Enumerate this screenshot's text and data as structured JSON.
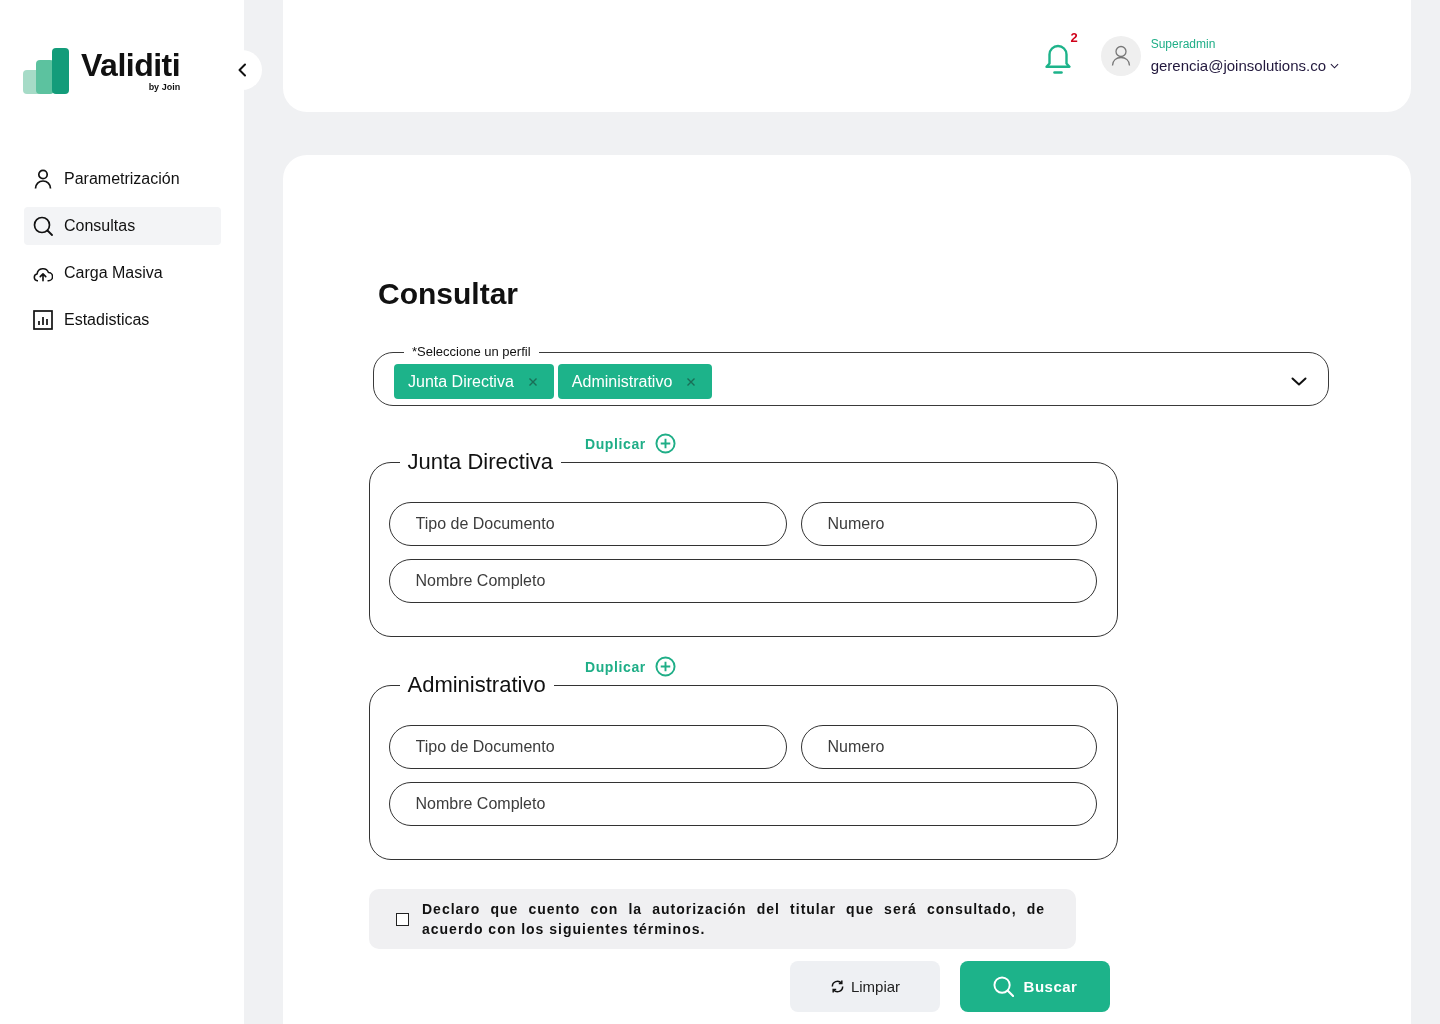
{
  "sidebar": {
    "logo": {
      "wordmark": "Validiti",
      "tagline": "by Join"
    },
    "items": [
      {
        "label": "Parametrización",
        "selected": false
      },
      {
        "label": "Consultas",
        "selected": true
      },
      {
        "label": "Carga Masiva",
        "selected": false
      },
      {
        "label": "Estadisticas",
        "selected": false
      }
    ]
  },
  "header": {
    "notifications": {
      "count": "2"
    },
    "user": {
      "role": "Superadmin",
      "email": "gerencia@joinsolutions.co"
    }
  },
  "content": {
    "title": "Consultar",
    "profile_select": {
      "label": "*Seleccione un perfil",
      "chips": [
        "Junta Directiva",
        "Administrativo"
      ]
    },
    "sections": [
      {
        "title": "Junta Directiva",
        "action": "Duplicar",
        "rows": [
          [
            {
              "placeholder": "Tipo de Documento"
            },
            {
              "placeholder": "Numero"
            }
          ],
          [
            {
              "placeholder": "Nombre Completo"
            }
          ]
        ]
      },
      {
        "title": "Administrativo",
        "action": "Duplicar",
        "rows": [
          [
            {
              "placeholder": "Tipo de Documento"
            },
            {
              "placeholder": "Numero"
            }
          ],
          [
            {
              "placeholder": "Nombre Completo"
            }
          ]
        ]
      }
    ],
    "consent": {
      "checked": false,
      "text": "Declaro que cuento con la autorización del titular que será consultado, de acuerdo con los siguientes términos."
    },
    "buttons": [
      {
        "label": "Limpiar",
        "kind": "secondary"
      },
      {
        "label": "Buscar",
        "kind": "primary"
      }
    ]
  }
}
